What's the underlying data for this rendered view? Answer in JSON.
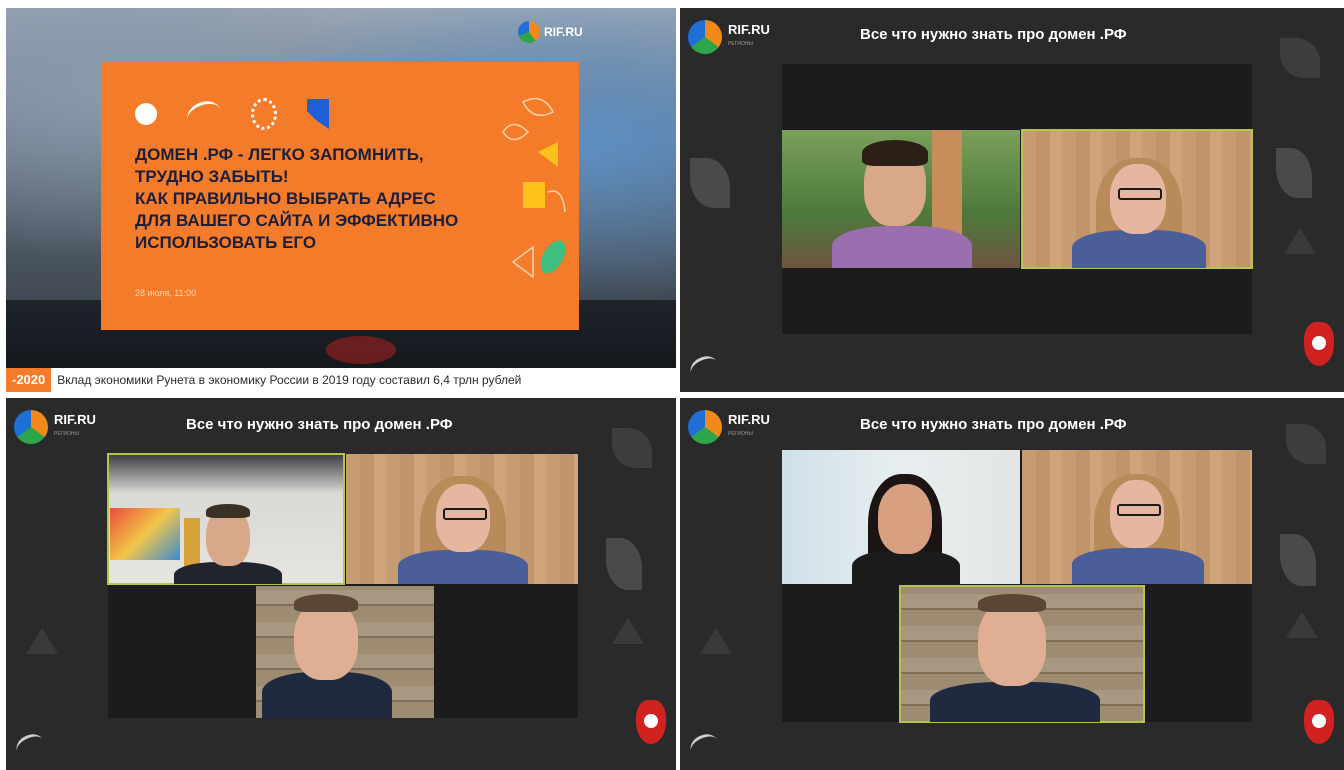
{
  "panel1": {
    "logo_text": "RIF.RU",
    "slide_title_lines": [
      "ДОМЕН .РФ - ЛЕГКО ЗАПОМНИТЬ,",
      "ТРУДНО ЗАБЫТЬ!",
      "КАК ПРАВИЛЬНО ВЫБРАТЬ АДРЕС",
      "ДЛЯ ВАШЕГО САЙТА И ЭФФЕКТИВНО",
      "ИСПОЛЬЗОВАТЬ ЕГО"
    ],
    "slide_date": "28 июля, 11:00",
    "ticker_tag": "-2020",
    "ticker_text": "Вклад экономики Рунета в экономику России в 2019 году составил 6,4 трлн рублей"
  },
  "conference": {
    "logo_text": "RIF.RU",
    "title": "Все что нужно знать про домен .РФ"
  },
  "colors": {
    "slide_orange": "#f47b2a",
    "active_speaker": "#b5c44a",
    "panel_bg": "#2a2a2a"
  }
}
